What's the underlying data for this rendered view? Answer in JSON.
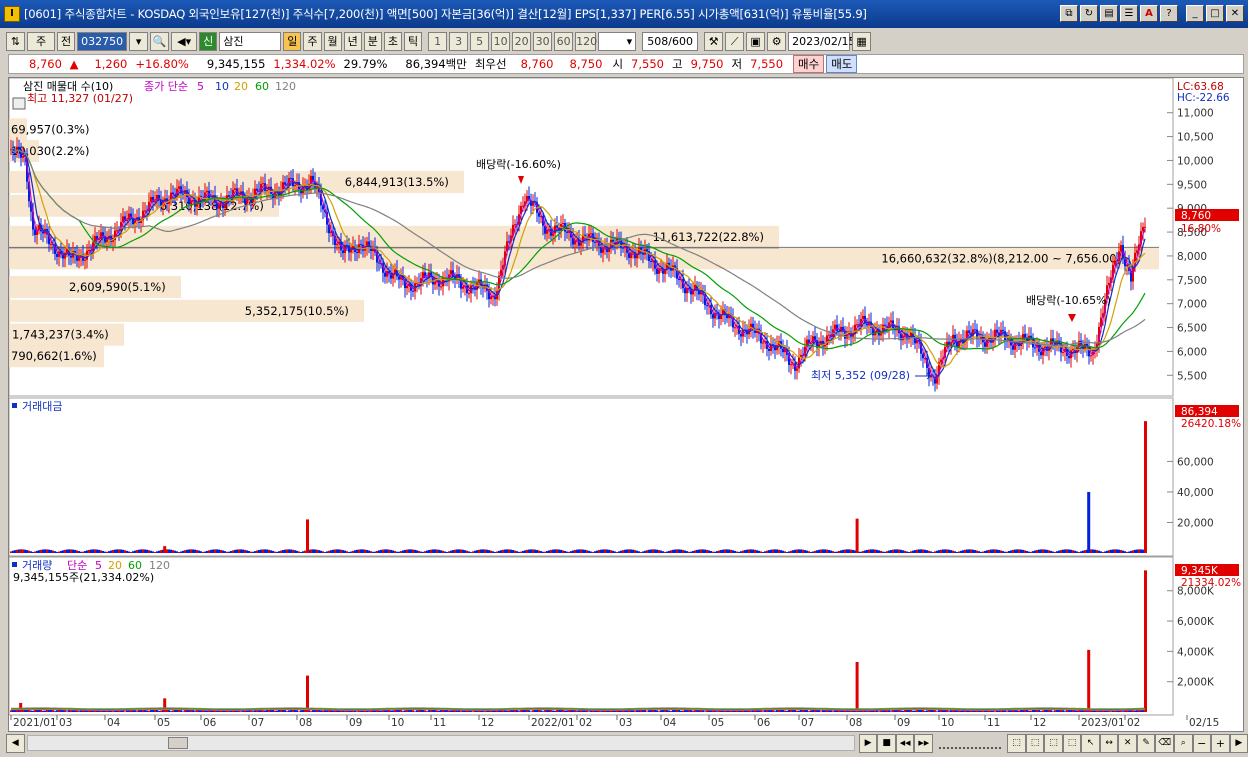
{
  "window": {
    "title": "[0601] 주식종합차트 - KOSDAQ 외국인보유[127(천)] 주식수[7,200(천)] 액면[500] 자본금[36(억)] 결산[12월] EPS[1,337] PER[6.55] 시가총액[631(억)] 유통비율[55.9]",
    "app_icon": "I"
  },
  "toolbar": {
    "period_select": "주",
    "prev_label": "전",
    "code": "032750",
    "credit_label": "신",
    "stock_name": "삼진",
    "timeframes": [
      "일",
      "주",
      "월",
      "년",
      "분",
      "초",
      "틱"
    ],
    "selected_timeframe": "일",
    "intervals": [
      "1",
      "3",
      "5",
      "10",
      "20",
      "30",
      "60",
      "120"
    ],
    "count": "508",
    "count_total": "/600",
    "date": "2023/02/15"
  },
  "quote": {
    "price": "8,760",
    "change": "1,260",
    "change_pct": "+16.80%",
    "volume": "9,345,155",
    "volume_pct": "1,334.02%",
    "turnover": "29.79%",
    "amount": "86,394백만",
    "priority_label": "최우선",
    "ask": "8,760",
    "bid": "8,750",
    "open_label": "시",
    "open": "7,550",
    "high_label": "고",
    "high": "9,750",
    "low_label": "저",
    "low": "7,550",
    "buy_label": "매수",
    "sell_label": "매도"
  },
  "chart_data": {
    "type": "candlestick",
    "symbol": "삼진",
    "price_panel": {
      "legend_title": "삼진 매물대 수(10)",
      "ma_label": "종가 단순",
      "ma_periods": [
        "5",
        "10",
        "20",
        "60",
        "120"
      ],
      "ma_colors": [
        "#c000c0",
        "#1030c0",
        "#d4a000",
        "#00a000",
        "#808080"
      ],
      "lc": "LC:63.68",
      "hc": "HC:-22.66",
      "yticks": [
        11000,
        10500,
        10000,
        9500,
        9000,
        8500,
        8000,
        7500,
        7000,
        6500,
        6000,
        5500
      ],
      "ylim": [
        5150,
        11350
      ],
      "current_price": "8,760",
      "current_pct": "16.80%",
      "high_annotation": "최고 11,327 (01/27)",
      "low_annotation": "최저 5,352 (09/28)",
      "dividend_annotations": [
        "배당락(-16.60%)",
        "배당락(-10.65%)"
      ],
      "volume_profile": [
        {
          "label": "69,957(0.3%)",
          "price": 10650
        },
        {
          "label": "10,030(2.2%)",
          "price": 10200
        },
        {
          "label": "6,844,913(13.5%)",
          "price": 9550
        },
        {
          "label": "6,310,138(12.7%)",
          "price": 9050
        },
        {
          "label": "11,613,722(22.8%)",
          "price": 8400
        },
        {
          "label": "16,660,632(32.8%)(8,212.00 ~ 7,656.00)",
          "price": 7950
        },
        {
          "label": "2,609,590(5.1%)",
          "price": 7350
        },
        {
          "label": "5,352,175(10.5%)",
          "price": 6850
        },
        {
          "label": "1,743,237(3.4%)",
          "price": 6350
        },
        {
          "label": "790,662(1.6%)",
          "price": 5900
        }
      ]
    },
    "amount_panel": {
      "title": "거래대금",
      "yticks": [
        60000,
        40000,
        20000
      ],
      "ylim": [
        0,
        95000
      ],
      "current": "86,394",
      "current_pct": "26420.18%"
    },
    "volume_panel": {
      "title": "거래량",
      "ma_label": "단순",
      "ma_periods": [
        "5",
        "20",
        "60",
        "120"
      ],
      "ma_colors": [
        "#c000c0",
        "#d4a000",
        "#00a000",
        "#808080"
      ],
      "info": "9,345,155주(21,334.02%)",
      "yticks": [
        "8,000K",
        "6,000K",
        "4,000K",
        "2,000K"
      ],
      "ytick_values": [
        8000,
        6000,
        4000,
        2000
      ],
      "ylim": [
        0,
        9500
      ],
      "current": "9,345K",
      "current_pct": "21334.02%"
    },
    "x_axis": {
      "labels": [
        "2021/01",
        "03",
        "04",
        "05",
        "06",
        "07",
        "08",
        "09",
        "10",
        "11",
        "12",
        "2022/01",
        "02",
        "03",
        "04",
        "05",
        "06",
        "07",
        "08",
        "09",
        "10",
        "11",
        "12",
        "2023/01",
        "02",
        "02/15"
      ]
    },
    "close_path": [
      [
        "2021/01",
        10100
      ],
      [
        "2021/02",
        8600
      ],
      [
        "2021/03",
        7900
      ],
      [
        "2021/04",
        8600
      ],
      [
        "2021/05",
        9300
      ],
      [
        "2021/06",
        9150
      ],
      [
        "2021/07",
        9350
      ],
      [
        "2021/08",
        9550
      ],
      [
        "2021/08",
        8000
      ],
      [
        "2021/09",
        8300
      ],
      [
        "2021/10",
        7400
      ],
      [
        "2021/11",
        7550
      ],
      [
        "2021/12",
        7200
      ],
      [
        "2021/12",
        9300
      ],
      [
        "2022/01",
        8650
      ],
      [
        "2022/02",
        8300
      ],
      [
        "2022/03",
        8150
      ],
      [
        "2022/04",
        7600
      ],
      [
        "2022/05",
        6700
      ],
      [
        "2022/06",
        6200
      ],
      [
        "2022/06",
        5750
      ],
      [
        "2022/07",
        6200
      ],
      [
        "2022/08",
        6550
      ],
      [
        "2022/09",
        6400
      ],
      [
        "2022/09",
        5450
      ],
      [
        "2022/10",
        6300
      ],
      [
        "2022/11",
        6300
      ],
      [
        "2022/12",
        6100
      ],
      [
        "2023/01",
        6000
      ],
      [
        "2023/01",
        8300
      ],
      [
        "2023/02",
        7500
      ],
      [
        "2023/02",
        8760
      ]
    ],
    "volume_spikes": [
      [
        "2021/01",
        600
      ],
      [
        "2021/05",
        900
      ],
      [
        "2021/08",
        2400
      ],
      [
        "2022/08",
        3300
      ],
      [
        "2023/01",
        4100
      ],
      [
        "2023/02",
        9345
      ]
    ],
    "amount_spikes": [
      [
        "2021/01",
        1700
      ],
      [
        "2021/05",
        4500
      ],
      [
        "2021/08",
        22000
      ],
      [
        "2022/08",
        22500
      ],
      [
        "2023/01",
        40000
      ],
      [
        "2023/02",
        86394
      ]
    ]
  },
  "bottombar": {
    "left_arrow": "◀",
    "controls": [
      "▶",
      "■",
      "◀◀",
      "▶▶"
    ]
  }
}
